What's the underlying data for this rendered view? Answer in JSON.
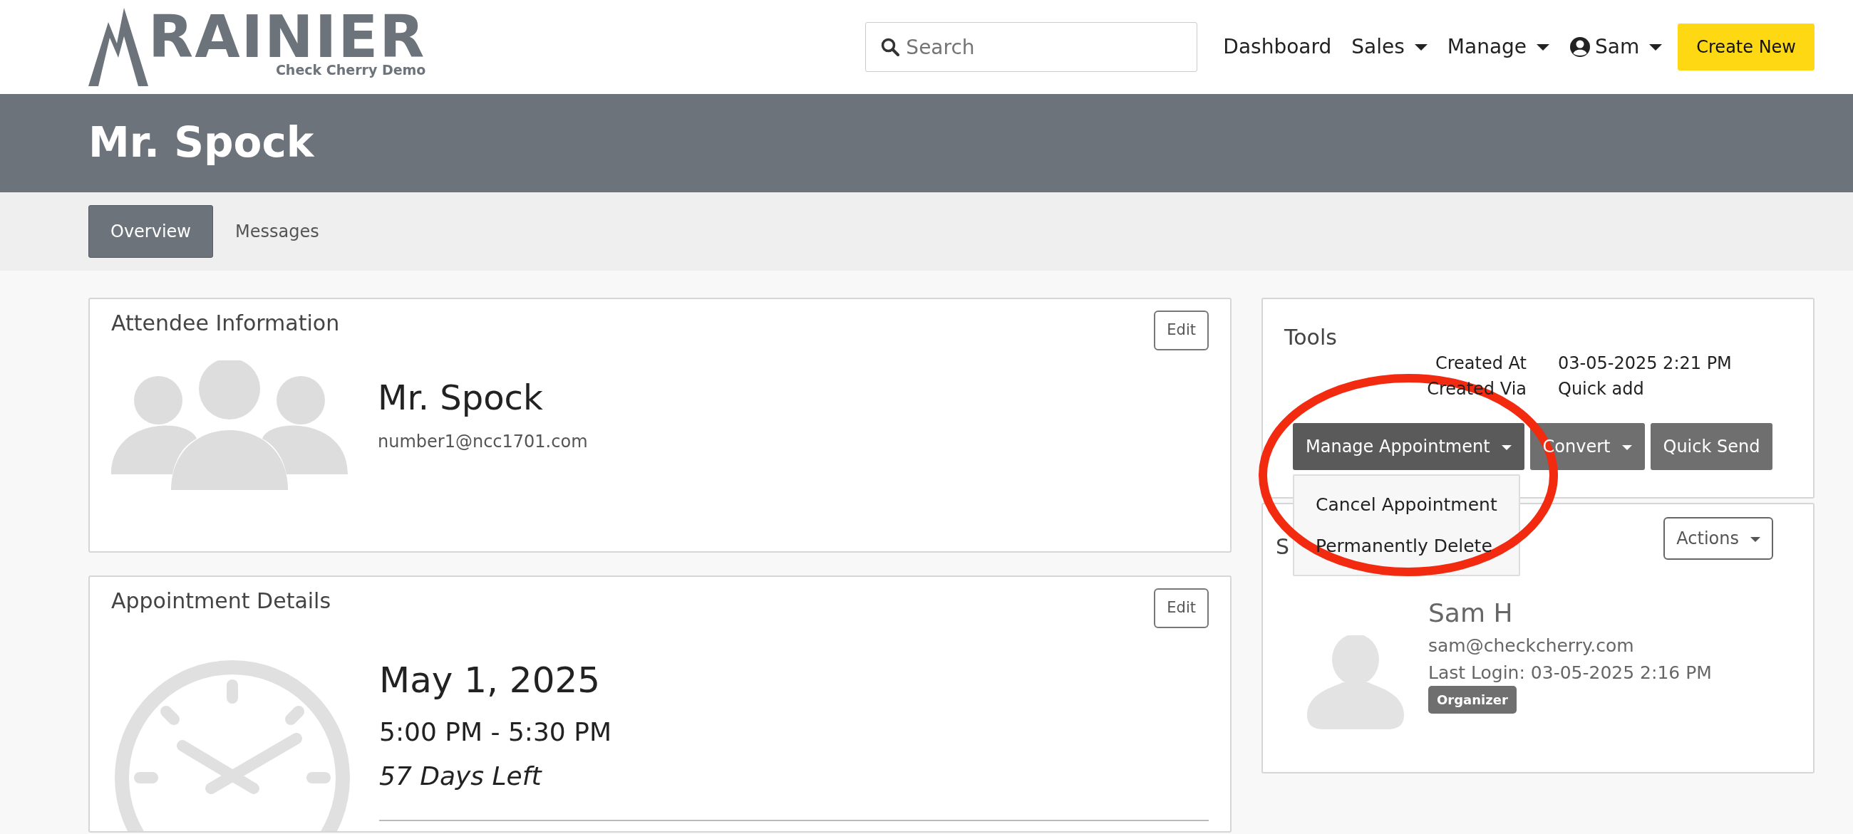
{
  "brand": {
    "name": "RAINIER",
    "tagline": "Check Cherry Demo"
  },
  "search": {
    "placeholder": "Search"
  },
  "nav": [
    {
      "label": "Dashboard",
      "dropdown": false,
      "kind": "link"
    },
    {
      "label": "Sales",
      "dropdown": true,
      "kind": "link"
    },
    {
      "label": "Manage",
      "dropdown": true,
      "kind": "link"
    },
    {
      "label": "Sam",
      "dropdown": true,
      "kind": "user"
    }
  ],
  "create_button": "Create New",
  "page_title": "Mr. Spock",
  "tabs": [
    {
      "label": "Overview",
      "selected": true
    },
    {
      "label": "Messages",
      "selected": false
    }
  ],
  "attendee_card": {
    "title": "Attendee Information",
    "edit_button": "Edit",
    "name": "Mr. Spock",
    "email": "number1@ncc1701.com"
  },
  "appointment_card": {
    "title": "Appointment Details",
    "edit_button": "Edit",
    "date": "May 1, 2025",
    "time": "5:00 PM - 5:30 PM",
    "days_left": "57 Days Left"
  },
  "tools_card": {
    "title": "Tools",
    "details": [
      {
        "label": "Created At",
        "value": "03-05-2025 2:21 PM"
      },
      {
        "label": "Created Via",
        "value": "Quick add"
      }
    ],
    "buttons": [
      {
        "label": "Manage Appointment",
        "dropdown": true,
        "expanded": true
      },
      {
        "label": "Convert",
        "dropdown": true,
        "expanded": false
      },
      {
        "label": "Quick Send",
        "dropdown": false,
        "expanded": false
      }
    ],
    "menu": [
      "Cancel Appointment",
      "Permanently Delete"
    ]
  },
  "staff_card": {
    "title": "S",
    "actions_button": "Actions",
    "name": "Sam H",
    "email": "sam@checkcherry.com",
    "last_login": "Last Login: 03-05-2025 2:16 PM",
    "badge": "Organizer"
  }
}
